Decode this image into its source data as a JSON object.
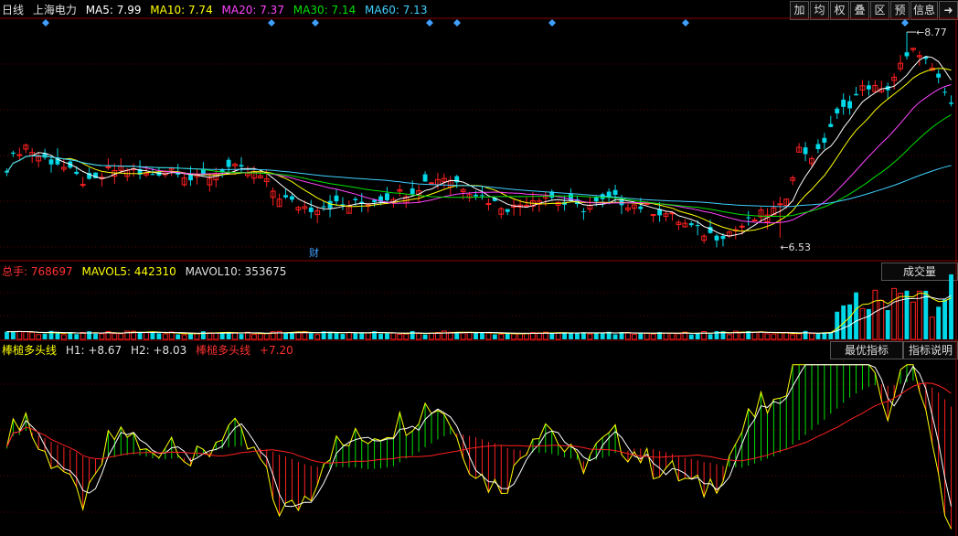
{
  "header": {
    "period": "日线",
    "stock": "上海电力",
    "ma": [
      {
        "label": "MA5: 7.99",
        "color": "#ffffff"
      },
      {
        "label": "MA10: 7.74",
        "color": "#ffff00"
      },
      {
        "label": "MA20: 7.37",
        "color": "#ff44ff"
      },
      {
        "label": "MA30: 7.14",
        "color": "#00e000"
      },
      {
        "label": "MA60: 7.13",
        "color": "#40d0ff"
      }
    ]
  },
  "toolbar": [
    "加",
    "均",
    "权",
    "叠",
    "区",
    "预",
    "信息"
  ],
  "price_panel": {
    "high_label": "8.77",
    "low_label": "6.53",
    "event_marker": "财"
  },
  "volume_panel": {
    "total_label": "总手: 768697",
    "mavol5_label": "MAVOL5: 442310",
    "mavol10_label": "MAVOL10: 353675",
    "tab": "成交量"
  },
  "indicator_panel": {
    "name": "棒槌多头线",
    "h1": "H1: +8.67",
    "h2": "H2: +8.03",
    "name2": "棒槌多头线",
    "value": "+7.20",
    "tab_best": "最优指标",
    "tab_explain": "指标说明"
  },
  "chart_data": {
    "type": "candlestick",
    "series_names": [
      "MA5",
      "MA10",
      "MA20",
      "MA30",
      "MA60"
    ],
    "close_trend": [
      7.3,
      7.55,
      7.4,
      7.35,
      7.2,
      7.1,
      7.25,
      7.3,
      7.2,
      7.25,
      7.3,
      7.15,
      7.2,
      7.3,
      7.25,
      7.2,
      7.0,
      6.9,
      6.85,
      6.9,
      6.88,
      6.9,
      6.95,
      7.0,
      7.05,
      7.15,
      7.2,
      7.1,
      7.0,
      6.9,
      6.85,
      6.95,
      7.0,
      6.9,
      6.85,
      6.9,
      6.95,
      6.9,
      6.85,
      6.8,
      6.7,
      6.6,
      6.55,
      6.6,
      6.7,
      6.8,
      6.85,
      7.5,
      7.4,
      7.8,
      8.0,
      8.2,
      8.1,
      8.4,
      8.6,
      8.3,
      7.99
    ],
    "high": 8.77,
    "low": 6.53,
    "ylim": [
      6.3,
      8.9
    ],
    "volume_last": 768697,
    "indicator_last": 7.2
  }
}
